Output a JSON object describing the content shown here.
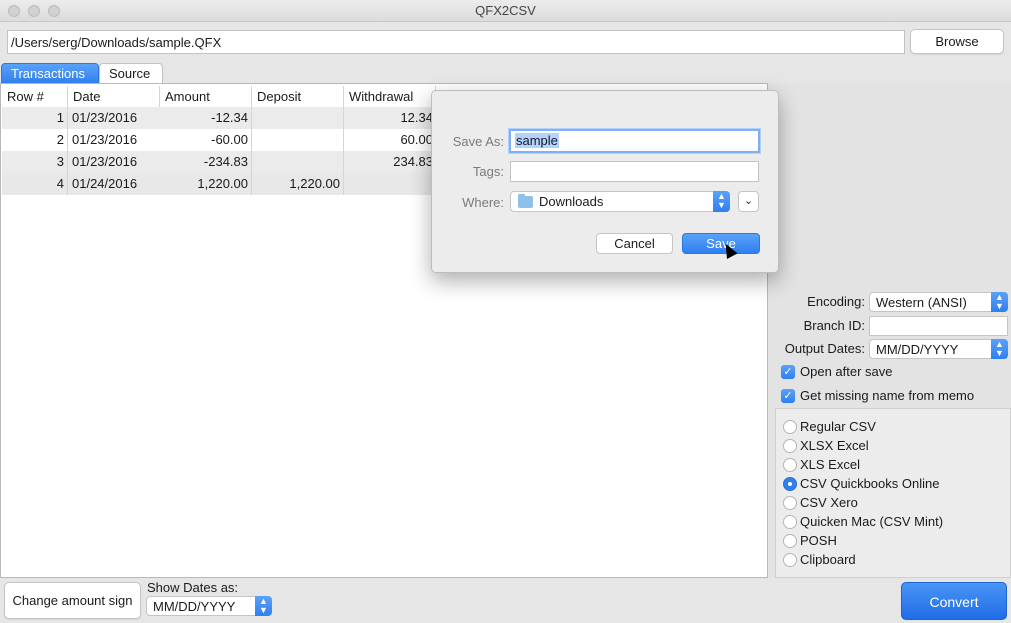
{
  "window": {
    "title": "QFX2CSV"
  },
  "toolbar": {
    "file_path": "/Users/serg/Downloads/sample.QFX",
    "browse_label": "Browse"
  },
  "tabs": [
    {
      "label": "Transactions",
      "active": true
    },
    {
      "label": "Source",
      "active": false
    }
  ],
  "table": {
    "columns": [
      "Row #",
      "Date",
      "Amount",
      "Deposit",
      "Withdrawal"
    ],
    "rows": [
      {
        "row": "1",
        "date": "01/23/2016",
        "amount": "-12.34",
        "deposit": "",
        "withdrawal": "12.34"
      },
      {
        "row": "2",
        "date": "01/23/2016",
        "amount": "-60.00",
        "deposit": "",
        "withdrawal": "60.00"
      },
      {
        "row": "3",
        "date": "01/23/2016",
        "amount": "-234.83",
        "deposit": "",
        "withdrawal": "234.83"
      },
      {
        "row": "4",
        "date": "01/24/2016",
        "amount": "1,220.00",
        "deposit": "1,220.00",
        "withdrawal": ""
      }
    ]
  },
  "settings": {
    "encoding_label": "Encoding:",
    "encoding_value": "Western (ANSI)",
    "branch_label": "Branch ID:",
    "branch_value": "",
    "output_dates_label": "Output Dates:",
    "output_dates_value": "MM/DD/YYYY",
    "open_after_save": "Open after save",
    "get_missing_name": "Get missing name from memo"
  },
  "formats": [
    {
      "label": "Regular CSV",
      "selected": false
    },
    {
      "label": "XLSX Excel",
      "selected": false
    },
    {
      "label": "XLS Excel",
      "selected": false
    },
    {
      "label": "CSV Quickbooks Online",
      "selected": true
    },
    {
      "label": "CSV Xero",
      "selected": false
    },
    {
      "label": "Quicken Mac (CSV Mint)",
      "selected": false
    },
    {
      "label": "POSH",
      "selected": false
    },
    {
      "label": "Clipboard",
      "selected": false
    }
  ],
  "bottom": {
    "change_amount_sign": "Change amount sign",
    "show_dates_label": "Show Dates as:",
    "show_dates_value": "MM/DD/YYYY",
    "convert_label": "Convert"
  },
  "save_dialog": {
    "save_as_label": "Save As:",
    "save_as_value": "sample",
    "tags_label": "Tags:",
    "tags_value": "",
    "where_label": "Where:",
    "where_value": "Downloads",
    "cancel_label": "Cancel",
    "save_label": "Save"
  },
  "colors": {
    "accent": "#2f7ff0",
    "window_bg": "#e6e6e6"
  }
}
